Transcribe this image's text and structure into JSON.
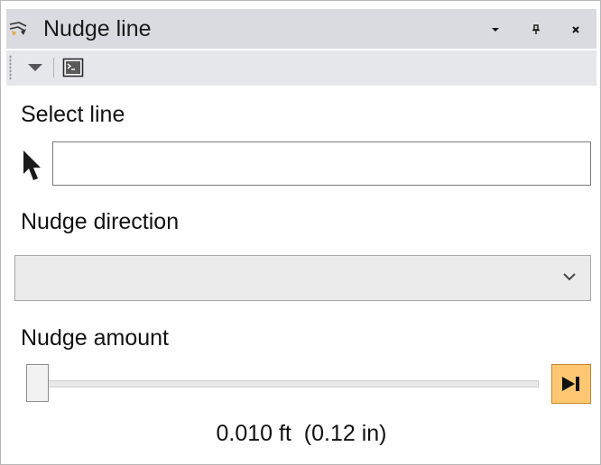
{
  "window": {
    "title": "Nudge line",
    "menu_icon": "chevron-down-icon",
    "pin_icon": "pin-icon",
    "close_icon": "close-icon"
  },
  "toolbar": {
    "dropdown_icon": "triangle-down-icon",
    "console_icon": "console-icon"
  },
  "select_line": {
    "label": "Select line",
    "value": "",
    "icon": "pointer-arrow-icon"
  },
  "nudge_direction": {
    "label": "Nudge direction",
    "selected": "",
    "icon": "chevron-down-icon"
  },
  "nudge_amount": {
    "label": "Nudge amount",
    "slider_level": 0,
    "end_button_icon": "skip-to-end-icon",
    "value_text": "0.010 ft  (0.12 in)"
  },
  "colors": {
    "title_bar_bg": "#dadbe0",
    "toolbar_bg": "#e6e7eb",
    "end_button_fill": "#ffc772",
    "end_button_border": "#c7842b"
  }
}
